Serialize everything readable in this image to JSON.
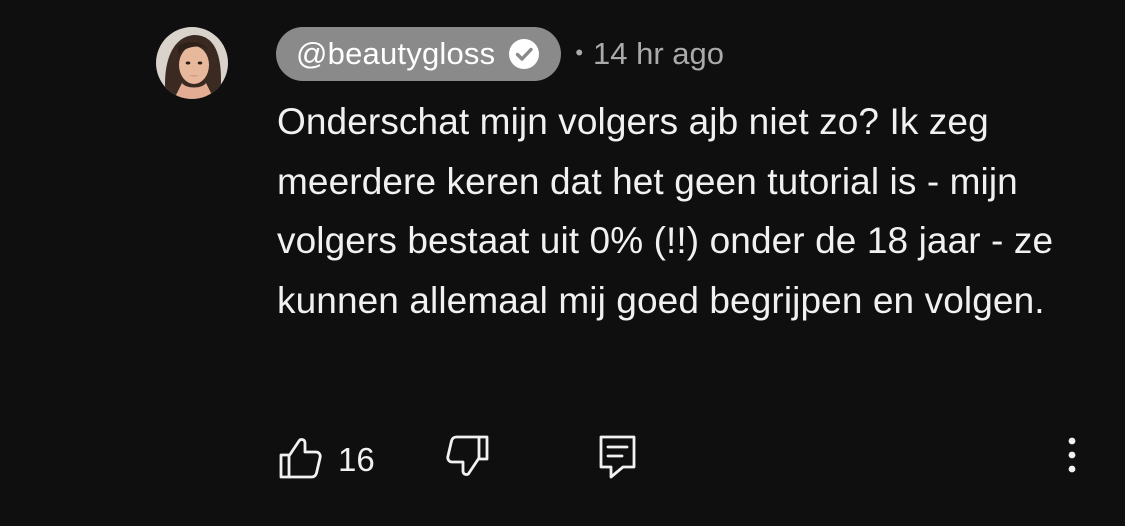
{
  "comment": {
    "author_handle": "@beautygloss",
    "verified": true,
    "separator": "•",
    "timestamp": "14 hr ago",
    "text": "Onderschat mijn volgers ajb niet zo? Ik zeg meerdere keren dat het geen tutorial is - mijn volgers bestaat uit 0% (!!) onder de 18 jaar - ze kunnen allemaal mij goed begrijpen en volgen.",
    "like_count": "16"
  },
  "icons": {
    "avatar": "profile-photo",
    "verified": "check-circle-icon",
    "like": "thumbs-up-icon",
    "dislike": "thumbs-down-icon",
    "reply": "comment-icon",
    "more": "vertical-ellipsis-icon"
  },
  "colors": {
    "background": "#0f0f0f",
    "handle_chip": "#8a8a8a",
    "text": "#f1f1f1",
    "meta": "#aaaaaa"
  }
}
